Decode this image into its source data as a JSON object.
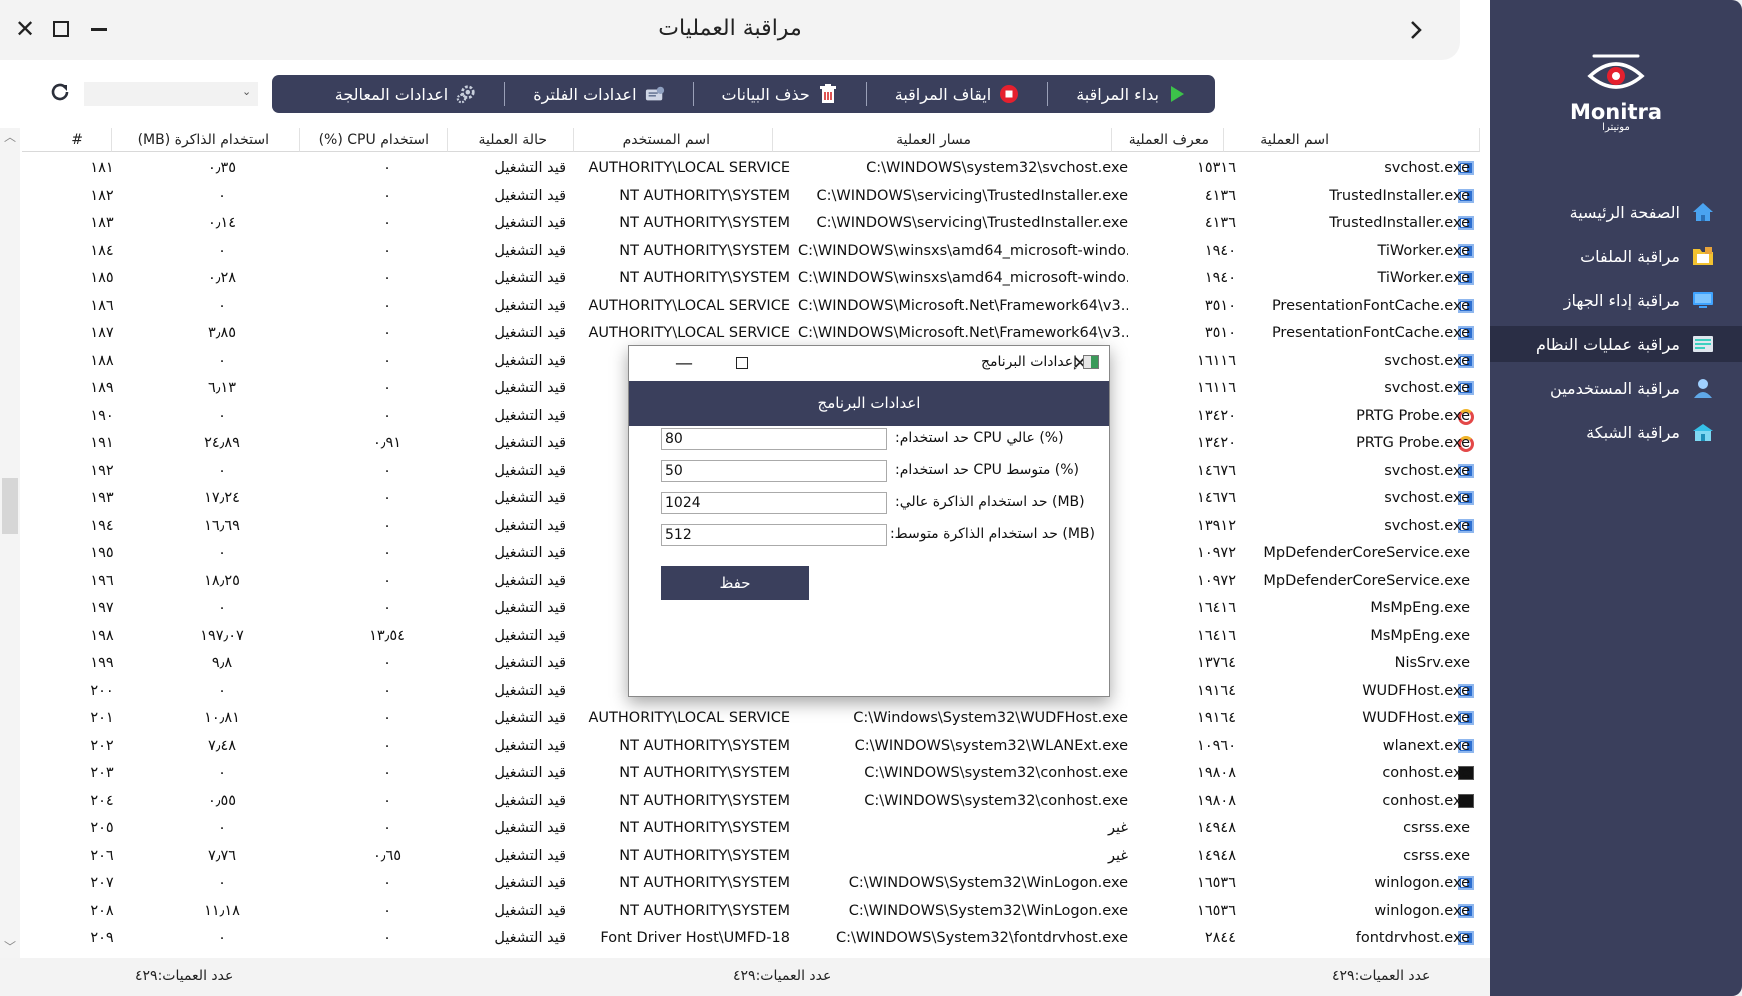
{
  "window": {
    "title": "مراقبة العمليات",
    "close_icon": "close-icon",
    "maximize_icon": "maximize-icon",
    "minimize_icon": "minimize-icon",
    "back_icon": "chevron-right-icon"
  },
  "toolbar": {
    "start": "بداء المراقبة",
    "stop": "ايقاف المراقبة",
    "delete": "حذف البيانات",
    "filter_settings": "اعدادات الفلترة",
    "processing_settings": "اعدادات المعالجة",
    "select_value": ""
  },
  "table": {
    "headers": {
      "name": "اسم العملية",
      "pid": "معرف العملية",
      "path": "مسار العملية",
      "user": "اسم المستخدم",
      "status": "حالة العملية",
      "cpu": "استخدام CPU (%)",
      "mem": "استخدام الذاكرة (MB)",
      "num": "#"
    },
    "rows": [
      {
        "name": "svchost.exe",
        "pid": "١٥٣١٦",
        "path": "C:\\WINDOWS\\system32\\svchost.exe",
        "user": "AUTHORITY\\LOCAL SERVICE",
        "status": "قيد التشغيل",
        "cpu": "٠",
        "mem": "٠٫٣٥",
        "num": "١٨١",
        "icon": "win"
      },
      {
        "name": "TrustedInstaller.exe",
        "pid": "٤١٣٦",
        "path": "C:\\WINDOWS\\servicing\\TrustedInstaller.exe",
        "user": "NT AUTHORITY\\SYSTEM",
        "status": "قيد التشغيل",
        "cpu": "٠",
        "mem": "٠",
        "num": "١٨٢",
        "icon": "win"
      },
      {
        "name": "TrustedInstaller.exe",
        "pid": "٤١٣٦",
        "path": "C:\\WINDOWS\\servicing\\TrustedInstaller.exe",
        "user": "NT AUTHORITY\\SYSTEM",
        "status": "قيد التشغيل",
        "cpu": "٠",
        "mem": "٠٫١٤",
        "num": "١٨٣",
        "icon": "win"
      },
      {
        "name": "TiWorker.exe",
        "pid": "١٩٤٠",
        "path": "C:\\WINDOWS\\winsxs\\amd64_microsoft-windo...",
        "user": "NT AUTHORITY\\SYSTEM",
        "status": "قيد التشغيل",
        "cpu": "٠",
        "mem": "٠",
        "num": "١٨٤",
        "icon": "win"
      },
      {
        "name": "TiWorker.exe",
        "pid": "١٩٤٠",
        "path": "C:\\WINDOWS\\winsxs\\amd64_microsoft-windo...",
        "user": "NT AUTHORITY\\SYSTEM",
        "status": "قيد التشغيل",
        "cpu": "٠",
        "mem": "٠٫٢٨",
        "num": "١٨٥",
        "icon": "win"
      },
      {
        "name": "PresentationFontCache.exe",
        "pid": "٣٥١٠",
        "path": "C:\\WINDOWS\\Microsoft.Net\\Framework64\\v3....",
        "user": "AUTHORITY\\LOCAL SERVICE",
        "status": "قيد التشغيل",
        "cpu": "٠",
        "mem": "٠",
        "num": "١٨٦",
        "icon": "win"
      },
      {
        "name": "PresentationFontCache.exe",
        "pid": "٣٥١٠",
        "path": "C:\\WINDOWS\\Microsoft.Net\\Framework64\\v3....",
        "user": "AUTHORITY\\LOCAL SERVICE",
        "status": "قيد التشغيل",
        "cpu": "٠",
        "mem": "٣٫٨٥",
        "num": "١٨٧",
        "icon": "win"
      },
      {
        "name": "svchost.exe",
        "pid": "١٦١١٦",
        "path": "",
        "user": "AUTHO",
        "status": "قيد التشغيل",
        "cpu": "٠",
        "mem": "٠",
        "num": "١٨٨",
        "icon": "win"
      },
      {
        "name": "svchost.exe",
        "pid": "١٦١١٦",
        "path": "",
        "user": "AUTHO",
        "status": "قيد التشغيل",
        "cpu": "٠",
        "mem": "٦٫١٣",
        "num": "١٨٩",
        "icon": "win"
      },
      {
        "name": "PRTG Probe.exe",
        "pid": "١٣٤٢٠",
        "path": "",
        "user": "NT",
        "status": "قيد التشغيل",
        "cpu": "٠",
        "mem": "٠",
        "num": "١٩٠",
        "icon": "gauge"
      },
      {
        "name": "PRTG Probe.exe",
        "pid": "١٣٤٢٠",
        "path": "",
        "user": "NT",
        "status": "قيد التشغيل",
        "cpu": "٠٫٩١",
        "mem": "٢٤٫٨٩",
        "num": "١٩١",
        "icon": "gauge"
      },
      {
        "name": "svchost.exe",
        "pid": "١٤٦٧٦",
        "path": "",
        "user": "NT",
        "status": "قيد التشغيل",
        "cpu": "٠",
        "mem": "٠",
        "num": "١٩٢",
        "icon": "win"
      },
      {
        "name": "svchost.exe",
        "pid": "١٤٦٧٦",
        "path": "",
        "user": "NT",
        "status": "قيد التشغيل",
        "cpu": "٠",
        "mem": "١٧٫٢٤",
        "num": "١٩٣",
        "icon": "win"
      },
      {
        "name": "svchost.exe",
        "pid": "١٣٩١٢",
        "path": "",
        "user": "NT",
        "status": "قيد التشغيل",
        "cpu": "٠",
        "mem": "١٦٫٦٩",
        "num": "١٩٤",
        "icon": "win"
      },
      {
        "name": "MpDefenderCoreService.exe",
        "pid": "١٠٩٧٢",
        "path": "",
        "user": "NT",
        "status": "قيد التشغيل",
        "cpu": "٠",
        "mem": "٠",
        "num": "١٩٥",
        "icon": ""
      },
      {
        "name": "MpDefenderCoreService.exe",
        "pid": "١٠٩٧٢",
        "path": "",
        "user": "NT",
        "status": "قيد التشغيل",
        "cpu": "٠",
        "mem": "١٨٫٢٥",
        "num": "١٩٦",
        "icon": ""
      },
      {
        "name": "MsMpEng.exe",
        "pid": "١٦٤١٦",
        "path": "",
        "user": "NT",
        "status": "قيد التشغيل",
        "cpu": "٠",
        "mem": "٠",
        "num": "١٩٧",
        "icon": ""
      },
      {
        "name": "MsMpEng.exe",
        "pid": "١٦٤١٦",
        "path": "",
        "user": "NT",
        "status": "قيد التشغيل",
        "cpu": "١٣٫٥٤",
        "mem": "١٩٧٫٠٧",
        "num": "١٩٨",
        "icon": ""
      },
      {
        "name": "NisSrv.exe",
        "pid": "١٣٧٦٤",
        "path": "",
        "user": "AUTHO",
        "status": "قيد التشغيل",
        "cpu": "٠",
        "mem": "٩٫٨",
        "num": "١٩٩",
        "icon": ""
      },
      {
        "name": "WUDFHost.exe",
        "pid": "١٩١٦٤",
        "path": "",
        "user": "AUTHO",
        "status": "قيد التشغيل",
        "cpu": "٠",
        "mem": "٠",
        "num": "٢٠٠",
        "icon": "win"
      },
      {
        "name": "WUDFHost.exe",
        "pid": "١٩١٦٤",
        "path": "C:\\Windows\\System32\\WUDFHost.exe",
        "user": "AUTHORITY\\LOCAL SERVICE",
        "status": "قيد التشغيل",
        "cpu": "٠",
        "mem": "١٠٫٨١",
        "num": "٢٠١",
        "icon": "win"
      },
      {
        "name": "wlanext.exe",
        "pid": "١٠٩٦٠",
        "path": "C:\\WINDOWS\\system32\\WLANExt.exe",
        "user": "NT AUTHORITY\\SYSTEM",
        "status": "قيد التشغيل",
        "cpu": "٠",
        "mem": "٧٫٤٨",
        "num": "٢٠٢",
        "icon": "win"
      },
      {
        "name": "conhost.exe",
        "pid": "١٩٨٠٨",
        "path": "C:\\WINDOWS\\system32\\conhost.exe",
        "user": "NT AUTHORITY\\SYSTEM",
        "status": "قيد التشغيل",
        "cpu": "٠",
        "mem": "٠",
        "num": "٢٠٣",
        "icon": "term"
      },
      {
        "name": "conhost.exe",
        "pid": "١٩٨٠٨",
        "path": "C:\\WINDOWS\\system32\\conhost.exe",
        "user": "NT AUTHORITY\\SYSTEM",
        "status": "قيد التشغيل",
        "cpu": "٠",
        "mem": "٠٫٥٥",
        "num": "٢٠٤",
        "icon": "term"
      },
      {
        "name": "csrss.exe",
        "pid": "١٤٩٤٨",
        "path": "غير",
        "user": "NT AUTHORITY\\SYSTEM",
        "status": "قيد التشغيل",
        "cpu": "٠",
        "mem": "٠",
        "num": "٢٠٥",
        "icon": ""
      },
      {
        "name": "csrss.exe",
        "pid": "١٤٩٤٨",
        "path": "غير",
        "user": "NT AUTHORITY\\SYSTEM",
        "status": "قيد التشغيل",
        "cpu": "٠٫٦٥",
        "mem": "٧٫٧٦",
        "num": "٢٠٦",
        "icon": ""
      },
      {
        "name": "winlogon.exe",
        "pid": "١٦٥٣٦",
        "path": "C:\\WINDOWS\\System32\\WinLogon.exe",
        "user": "NT AUTHORITY\\SYSTEM",
        "status": "قيد التشغيل",
        "cpu": "٠",
        "mem": "٠",
        "num": "٢٠٧",
        "icon": "win"
      },
      {
        "name": "winlogon.exe",
        "pid": "١٦٥٣٦",
        "path": "C:\\WINDOWS\\System32\\WinLogon.exe",
        "user": "NT AUTHORITY\\SYSTEM",
        "status": "قيد التشغيل",
        "cpu": "٠",
        "mem": "١١٫١٨",
        "num": "٢٠٨",
        "icon": "win"
      },
      {
        "name": "fontdrvhost.exe",
        "pid": "٢٨٤٤",
        "path": "C:\\WINDOWS\\System32\\fontdrvhost.exe",
        "user": "Font Driver Host\\UMFD-18",
        "status": "قيد التشغيل",
        "cpu": "٠",
        "mem": "٠",
        "num": "٢٠٩",
        "icon": "win"
      }
    ]
  },
  "footer": {
    "count_left": "عدد العميات:٤٢٩",
    "count_center": "عدد العميات:٤٢٩",
    "count_right": "عدد العميات:٤٢٩"
  },
  "sidebar": {
    "brand": "Monitra",
    "brand_sub": "مونيترا",
    "items": [
      {
        "label": "الصفحة الرئيسية",
        "icon": "home-icon",
        "color": "#4aa3f0"
      },
      {
        "label": "مراقبة الملفات",
        "icon": "folder-icon",
        "color": "#f2c230"
      },
      {
        "label": "مراقبة إداء الجهاز",
        "icon": "monitor-icon",
        "color": "#3fa3ff"
      },
      {
        "label": "مراقبة عمليات النظام",
        "icon": "process-icon",
        "color": "#3dd0c0"
      },
      {
        "label": "مراقبة المستخدمين",
        "icon": "user-icon",
        "color": "#9fd0ff"
      },
      {
        "label": "مراقبة الشبكة",
        "icon": "network-icon",
        "color": "#35c0e8"
      }
    ]
  },
  "modal": {
    "window_title": "إعدادات البرنامج",
    "header": "اعدادات البرنامج",
    "cpu_high_label": "(%) عالي CPU حد استخدام:",
    "cpu_high_value": "80",
    "cpu_mid_label": "(%) متوسط CPU حد استخدام:",
    "cpu_mid_value": "50",
    "mem_high_label": "(MB) حد استخدام الذاكرة عالي:",
    "mem_high_value": "1024",
    "mem_mid_label": "(MB) حد استخدام الذاكرة متوسط:",
    "mem_mid_value": "512",
    "save": "حفظ"
  },
  "colors": {
    "primary": "#3a3f5c",
    "sidebar_active": "#2a2e45"
  }
}
